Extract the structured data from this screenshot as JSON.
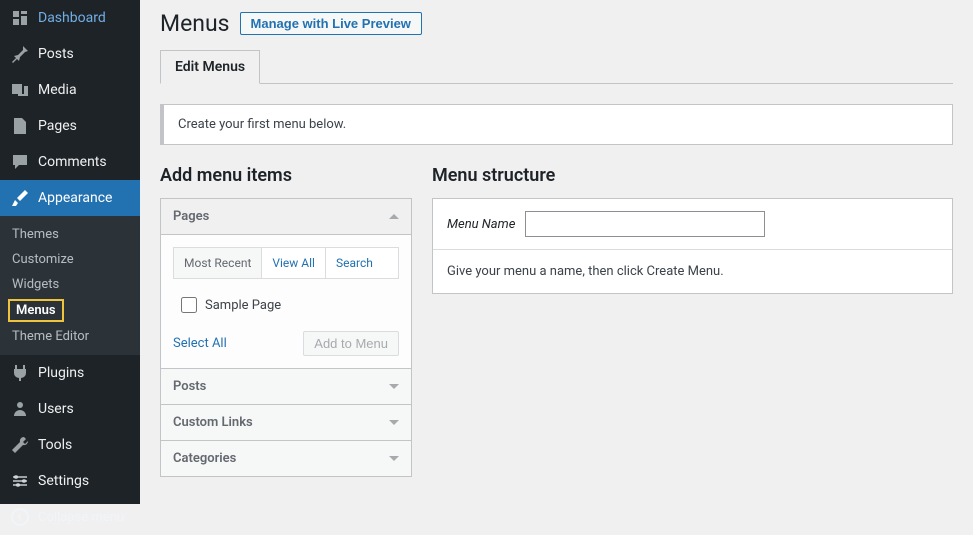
{
  "sidebar": {
    "items": [
      {
        "label": "Dashboard",
        "icon": "dashboard"
      },
      {
        "label": "Posts",
        "icon": "pin"
      },
      {
        "label": "Media",
        "icon": "media"
      },
      {
        "label": "Pages",
        "icon": "pages"
      },
      {
        "label": "Comments",
        "icon": "comment"
      },
      {
        "label": "Appearance",
        "icon": "brush",
        "active": true
      },
      {
        "label": "Plugins",
        "icon": "plug"
      },
      {
        "label": "Users",
        "icon": "users"
      },
      {
        "label": "Tools",
        "icon": "wrench"
      },
      {
        "label": "Settings",
        "icon": "sliders"
      }
    ],
    "submenu": [
      {
        "label": "Themes"
      },
      {
        "label": "Customize"
      },
      {
        "label": "Widgets"
      },
      {
        "label": "Menus",
        "current": true
      },
      {
        "label": "Theme Editor"
      }
    ],
    "collapse_label": "Collapse menu"
  },
  "header": {
    "title": "Menus",
    "preview_button": "Manage with Live Preview"
  },
  "tabs": {
    "edit": "Edit Menus"
  },
  "notice": "Create your first menu below.",
  "left": {
    "title": "Add menu items",
    "accordion": [
      {
        "label": "Pages",
        "open": true
      },
      {
        "label": "Posts",
        "open": false
      },
      {
        "label": "Custom Links",
        "open": false
      },
      {
        "label": "Categories",
        "open": false
      }
    ],
    "pages_tabs": [
      "Most Recent",
      "View All",
      "Search"
    ],
    "sample_item": "Sample Page",
    "select_all": "Select All",
    "add_button": "Add to Menu"
  },
  "right": {
    "title": "Menu structure",
    "name_label": "Menu Name",
    "name_value": "",
    "instruction": "Give your menu a name, then click Create Menu."
  }
}
